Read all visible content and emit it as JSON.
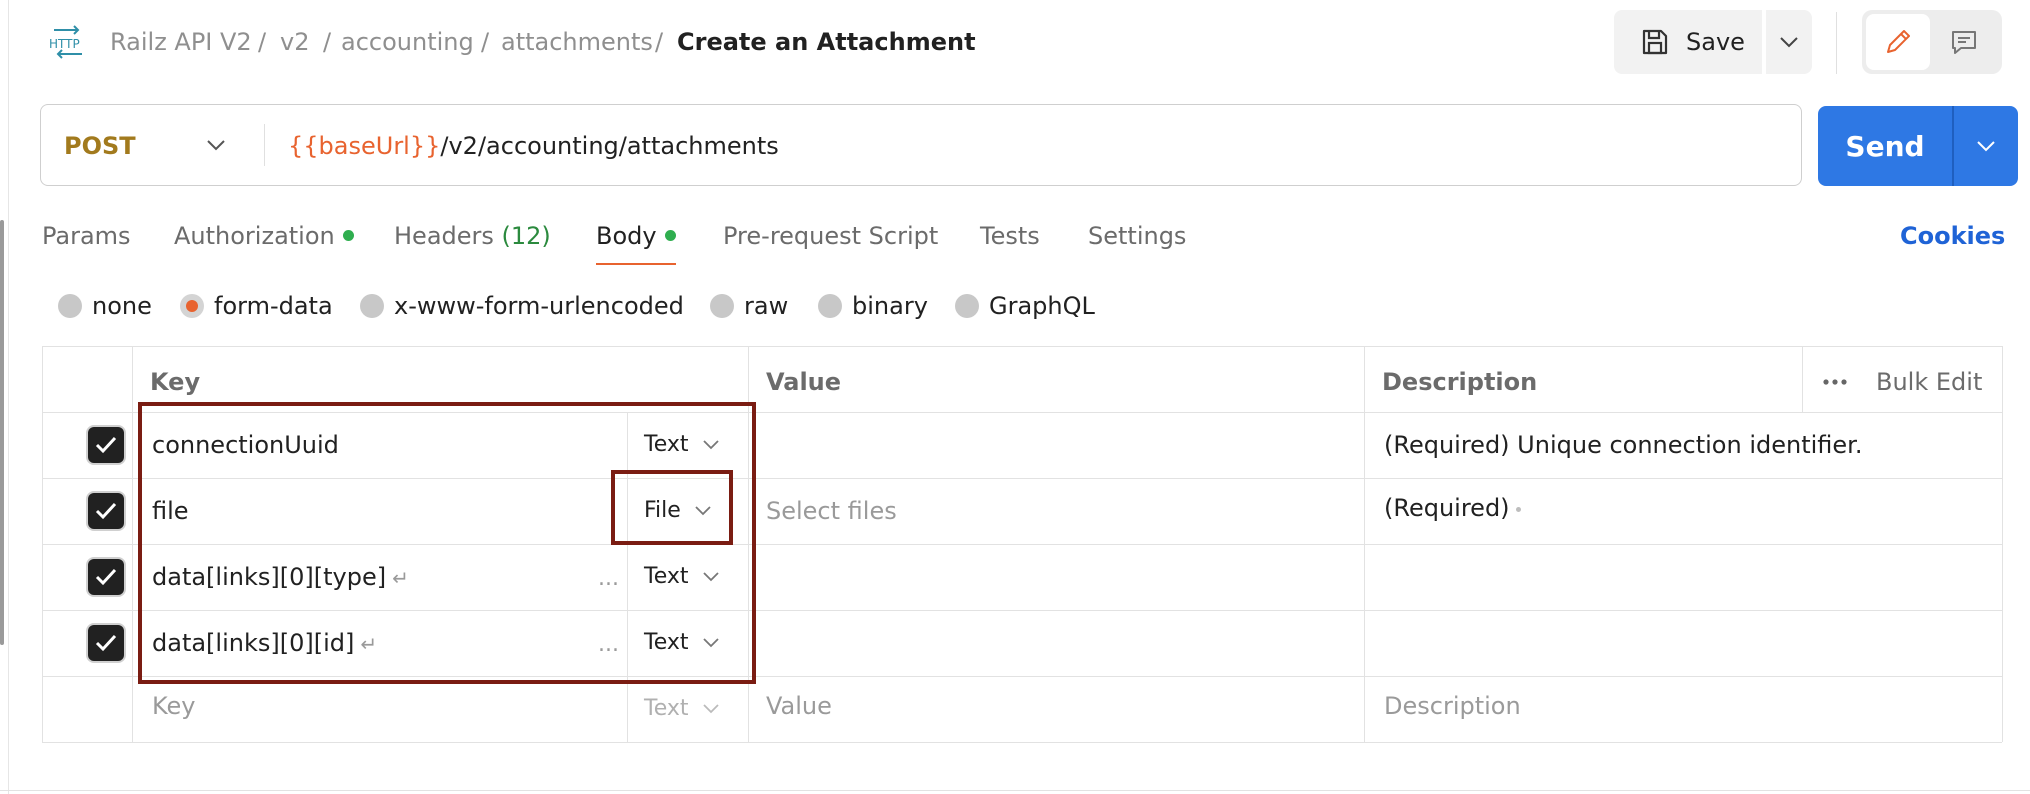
{
  "breadcrumb": {
    "items": [
      "Railz API V2",
      "v2",
      "accounting",
      "attachments"
    ],
    "separator": "/",
    "current": "Create an Attachment"
  },
  "header": {
    "http_icon_text": "HTTP",
    "save_label": "Save"
  },
  "request": {
    "method": "POST",
    "url_variable": "{{baseUrl}}",
    "url_path": "/v2/accounting/attachments",
    "send_label": "Send"
  },
  "tabs": {
    "params": "Params",
    "authorization": "Authorization",
    "headers": "Headers",
    "headers_count": "(12)",
    "body": "Body",
    "pre_request": "Pre-request Script",
    "tests": "Tests",
    "settings": "Settings",
    "active": "Body"
  },
  "cookies_label": "Cookies",
  "body_types": {
    "options": [
      "none",
      "form-data",
      "x-www-form-urlencoded",
      "raw",
      "binary",
      "GraphQL"
    ],
    "selected": "form-data"
  },
  "table": {
    "headers": {
      "key": "Key",
      "value": "Value",
      "description": "Description",
      "bulk_edit": "Bulk Edit"
    },
    "rows": [
      {
        "checked": true,
        "key": "connectionUuid",
        "type": "Text",
        "value": "",
        "description": "(Required) Unique connection identifier."
      },
      {
        "checked": true,
        "key": "file",
        "type": "File",
        "value_placeholder": "Select files",
        "description": "(Required)"
      },
      {
        "checked": true,
        "key": "data[links][0][type]",
        "type": "Text",
        "value": "",
        "description": ""
      },
      {
        "checked": true,
        "key": "data[links][0][id]",
        "type": "Text",
        "value": "",
        "description": ""
      }
    ],
    "placeholder_row": {
      "key": "Key",
      "type": "Text",
      "value": "Value",
      "description": "Description"
    },
    "enter_symbol": "↵",
    "more_symbol": "..."
  },
  "colors": {
    "accent_orange": "#e8632f",
    "send_blue": "#2e78e4",
    "method_gold": "#a27a1d",
    "annotation_red": "#7a1c12"
  }
}
